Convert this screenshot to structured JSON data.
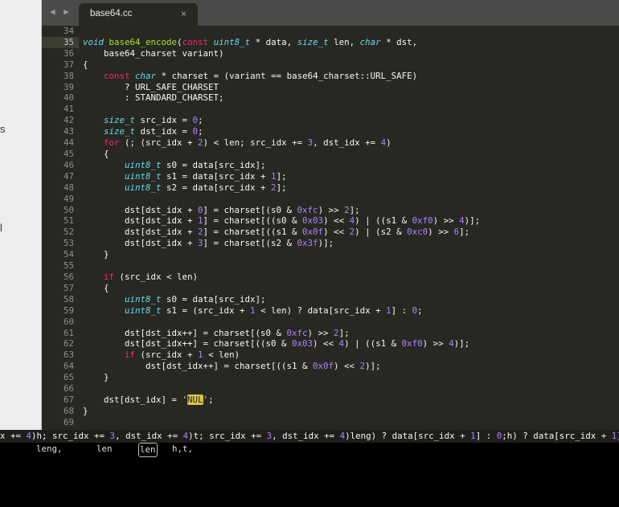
{
  "sidebar": {
    "fragments": [
      "s",
      "l"
    ]
  },
  "tabbar": {
    "nav": "◀ ▶",
    "tab_title": "base64.cc",
    "close": "×"
  },
  "editor": {
    "first_line": 34,
    "current_line": 35,
    "lines": [
      [],
      [
        [
          "ty",
          "void"
        ],
        [
          "t",
          " "
        ],
        [
          "fn",
          "base64_encode"
        ],
        [
          "t",
          "("
        ],
        [
          "kw",
          "const"
        ],
        [
          "t",
          " "
        ],
        [
          "ty",
          "uint8_t"
        ],
        [
          "t",
          " * data, "
        ],
        [
          "ty",
          "size_t"
        ],
        [
          "t",
          " len, "
        ],
        [
          "ty",
          "char"
        ],
        [
          "t",
          " * dst,"
        ]
      ],
      [
        [
          "t",
          "    base64_charset variant)"
        ]
      ],
      [
        [
          "t",
          "{"
        ]
      ],
      [
        [
          "t",
          "    "
        ],
        [
          "kw",
          "const"
        ],
        [
          "t",
          " "
        ],
        [
          "ty",
          "char"
        ],
        [
          "t",
          " * charset = (variant == base64_charset::URL_SAFE)"
        ]
      ],
      [
        [
          "t",
          "        ? URL_SAFE_CHARSET"
        ]
      ],
      [
        [
          "t",
          "        : STANDARD_CHARSET;"
        ]
      ],
      [],
      [
        [
          "t",
          "    "
        ],
        [
          "ty",
          "size_t"
        ],
        [
          "t",
          " src_idx = "
        ],
        [
          "nu",
          "0"
        ],
        [
          "t",
          ";"
        ]
      ],
      [
        [
          "t",
          "    "
        ],
        [
          "ty",
          "size_t"
        ],
        [
          "t",
          " dst_idx = "
        ],
        [
          "nu",
          "0"
        ],
        [
          "t",
          ";"
        ]
      ],
      [
        [
          "t",
          "    "
        ],
        [
          "kw",
          "for"
        ],
        [
          "t",
          " (; (src_idx + "
        ],
        [
          "nu",
          "2"
        ],
        [
          "t",
          ") < len; src_idx += "
        ],
        [
          "nu",
          "3"
        ],
        [
          "t",
          ", dst_idx += "
        ],
        [
          "nu",
          "4"
        ],
        [
          "t",
          ")"
        ]
      ],
      [
        [
          "t",
          "    {"
        ]
      ],
      [
        [
          "t",
          "        "
        ],
        [
          "ty",
          "uint8_t"
        ],
        [
          "t",
          " s0 = data[src_idx];"
        ]
      ],
      [
        [
          "t",
          "        "
        ],
        [
          "ty",
          "uint8_t"
        ],
        [
          "t",
          " s1 = data[src_idx + "
        ],
        [
          "nu",
          "1"
        ],
        [
          "t",
          "];"
        ]
      ],
      [
        [
          "t",
          "        "
        ],
        [
          "ty",
          "uint8_t"
        ],
        [
          "t",
          " s2 = data[src_idx + "
        ],
        [
          "nu",
          "2"
        ],
        [
          "t",
          "];"
        ]
      ],
      [],
      [
        [
          "t",
          "        dst[dst_idx + "
        ],
        [
          "nu",
          "0"
        ],
        [
          "t",
          "] = charset[(s0 & "
        ],
        [
          "nu",
          "0xfc"
        ],
        [
          "t",
          ") >> "
        ],
        [
          "nu",
          "2"
        ],
        [
          "t",
          "];"
        ]
      ],
      [
        [
          "t",
          "        dst[dst_idx + "
        ],
        [
          "nu",
          "1"
        ],
        [
          "t",
          "] = charset[((s0 & "
        ],
        [
          "nu",
          "0x03"
        ],
        [
          "t",
          ") << "
        ],
        [
          "nu",
          "4"
        ],
        [
          "t",
          ") | ((s1 & "
        ],
        [
          "nu",
          "0xf0"
        ],
        [
          "t",
          ") >> "
        ],
        [
          "nu",
          "4"
        ],
        [
          "t",
          ")];"
        ]
      ],
      [
        [
          "t",
          "        dst[dst_idx + "
        ],
        [
          "nu",
          "2"
        ],
        [
          "t",
          "] = charset[((s1 & "
        ],
        [
          "nu",
          "0x0f"
        ],
        [
          "t",
          ") << "
        ],
        [
          "nu",
          "2"
        ],
        [
          "t",
          ") | (s2 & "
        ],
        [
          "nu",
          "0xc0"
        ],
        [
          "t",
          ") >> "
        ],
        [
          "nu",
          "6"
        ],
        [
          "t",
          "];"
        ]
      ],
      [
        [
          "t",
          "        dst[dst_idx + "
        ],
        [
          "nu",
          "3"
        ],
        [
          "t",
          "] = charset[(s2 & "
        ],
        [
          "nu",
          "0x3f"
        ],
        [
          "t",
          ")];"
        ]
      ],
      [
        [
          "t",
          "    }"
        ]
      ],
      [],
      [
        [
          "t",
          "    "
        ],
        [
          "kw",
          "if"
        ],
        [
          "t",
          " (src_idx < len)"
        ]
      ],
      [
        [
          "t",
          "    {"
        ]
      ],
      [
        [
          "t",
          "        "
        ],
        [
          "ty",
          "uint8_t"
        ],
        [
          "t",
          " s0 = data[src_idx];"
        ]
      ],
      [
        [
          "t",
          "        "
        ],
        [
          "ty",
          "uint8_t"
        ],
        [
          "t",
          " s1 = (src_idx + "
        ],
        [
          "nu",
          "1"
        ],
        [
          "t",
          " < len) ? data[src_idx + "
        ],
        [
          "nu",
          "1"
        ],
        [
          "t",
          "] : "
        ],
        [
          "nu",
          "0"
        ],
        [
          "t",
          ";"
        ]
      ],
      [],
      [
        [
          "t",
          "        dst[dst_idx++] = charset[(s0 & "
        ],
        [
          "nu",
          "0xfc"
        ],
        [
          "t",
          ") >> "
        ],
        [
          "nu",
          "2"
        ],
        [
          "t",
          "];"
        ]
      ],
      [
        [
          "t",
          "        dst[dst_idx++] = charset[((s0 & "
        ],
        [
          "nu",
          "0x03"
        ],
        [
          "t",
          ") << "
        ],
        [
          "nu",
          "4"
        ],
        [
          "t",
          ") | ((s1 & "
        ],
        [
          "nu",
          "0xf0"
        ],
        [
          "t",
          ") >> "
        ],
        [
          "nu",
          "4"
        ],
        [
          "t",
          ")];"
        ]
      ],
      [
        [
          "t",
          "        "
        ],
        [
          "kw",
          "if"
        ],
        [
          "t",
          " (src_idx + "
        ],
        [
          "nu",
          "1"
        ],
        [
          "t",
          " < len)"
        ]
      ],
      [
        [
          "t",
          "            dst[dst_idx++] = charset[((s1 & "
        ],
        [
          "nu",
          "0x0f"
        ],
        [
          "t",
          ") << "
        ],
        [
          "nu",
          "2"
        ],
        [
          "t",
          ")];"
        ]
      ],
      [
        [
          "t",
          "    }"
        ]
      ],
      [],
      [
        [
          "t",
          "    dst[dst_idx] = "
        ],
        [
          "st",
          "'"
        ],
        [
          "hl",
          "NUL"
        ],
        [
          "st",
          "'"
        ],
        [
          "t",
          ";"
        ]
      ],
      [
        [
          "t",
          "}"
        ]
      ],
      []
    ]
  },
  "overlay": {
    "row1": [
      [
        "t",
        "x += "
      ],
      [
        "nu",
        "4"
      ],
      [
        "t",
        ")h; src_idx += "
      ],
      [
        "nu",
        "3"
      ],
      [
        "t",
        ", dst_idx += "
      ],
      [
        "nu",
        "4"
      ],
      [
        "t",
        ")t; src_idx += "
      ],
      [
        "nu",
        "3"
      ],
      [
        "t",
        ", dst_idx += "
      ],
      [
        "nu",
        "4"
      ],
      [
        "t",
        ")leng) ? data[src_idx + "
      ],
      [
        "nu",
        "1"
      ],
      [
        "t",
        "] : "
      ],
      [
        "nu",
        "0"
      ],
      [
        "t",
        ";h) ? data[src_idx + "
      ],
      [
        "nu",
        "1"
      ],
      [
        "t",
        "]"
      ]
    ],
    "row2": [
      "leng,",
      "len",
      "len",
      "h,t,"
    ]
  }
}
